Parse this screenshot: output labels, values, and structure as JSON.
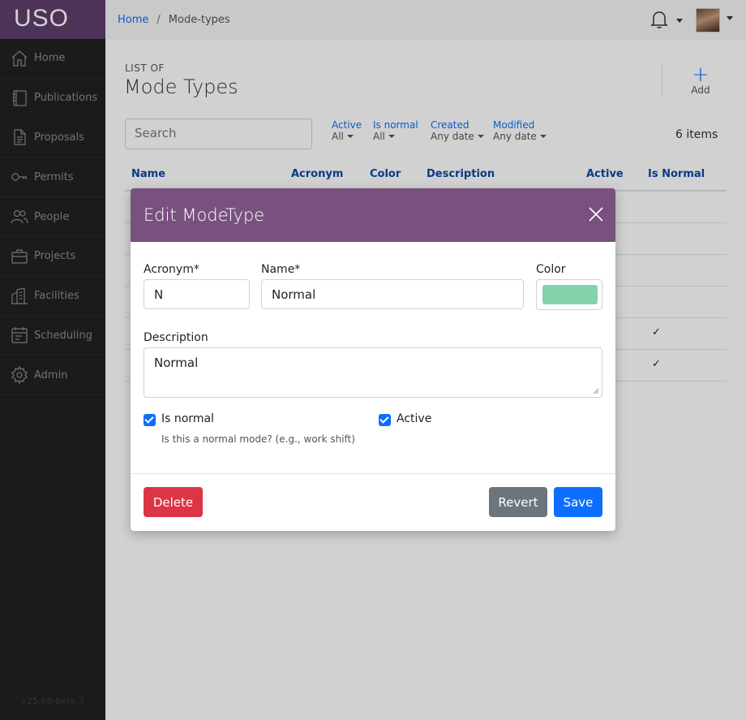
{
  "app": {
    "brand": "USO",
    "version": "v25.08-beta.3"
  },
  "sidebar": {
    "items": [
      {
        "label": "Home",
        "icon": "home-icon"
      },
      {
        "label": "Publications",
        "icon": "book-icon"
      },
      {
        "label": "Proposals",
        "icon": "file-icon"
      },
      {
        "label": "Permits",
        "icon": "key-icon"
      },
      {
        "label": "People",
        "icon": "people-icon"
      },
      {
        "label": "Projects",
        "icon": "briefcase-icon"
      },
      {
        "label": "Facilities",
        "icon": "building-icon"
      },
      {
        "label": "Scheduling",
        "icon": "calendar-icon"
      },
      {
        "label": "Admin",
        "icon": "gear-icon"
      }
    ]
  },
  "breadcrumb": {
    "home": "Home",
    "separator": "/",
    "current": "Mode-types"
  },
  "header": {
    "pre_title": "LIST OF",
    "title": "Mode Types",
    "add_label": "Add",
    "add_symbol": "+"
  },
  "search": {
    "placeholder": "Search"
  },
  "filters": [
    {
      "label": "Active",
      "value": "All"
    },
    {
      "label": "Is normal",
      "value": "All"
    },
    {
      "label": "Created",
      "value": "Any date"
    },
    {
      "label": "Modified",
      "value": "Any date"
    }
  ],
  "count": "6 items",
  "table": {
    "columns": [
      "Name",
      "Acronym",
      "Color",
      "Description",
      "Active",
      "Is Normal"
    ],
    "check_mark": "✓"
  },
  "modal": {
    "title": "Edit ModeType",
    "close_symbol": "×",
    "acronym_label": "Acronym*",
    "acronym_value": "N",
    "name_label": "Name*",
    "name_value": "Normal",
    "color_label": "Color",
    "color_value": "#84d2ac",
    "description_label": "Description",
    "description_value": "Normal",
    "is_normal_label": "Is normal",
    "is_normal_help": "Is this a normal mode? (e.g., work shift)",
    "active_label": "Active",
    "delete_label": "Delete",
    "revert_label": "Revert",
    "save_label": "Save"
  },
  "colors": {
    "brand": "#5f3f6c",
    "modal_header": "#79517f",
    "primary": "#0d6efd",
    "danger": "#dc3545",
    "secondary": "#6c757d"
  }
}
